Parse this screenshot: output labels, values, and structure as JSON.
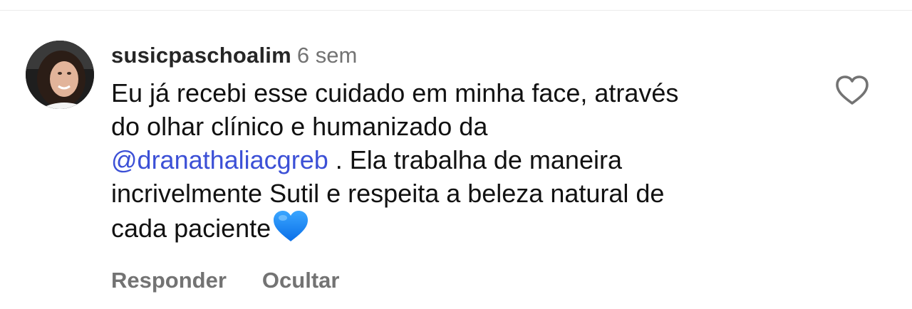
{
  "comment": {
    "username": "susicpaschoalim",
    "time_ago": "6 sem",
    "avatar_icon": "user-avatar-photo",
    "text": {
      "line1": "Eu já recebi  esse cuidado em minha face, através",
      "line2": "do olhar clínico e humanizado da",
      "mention": "@dranathaliacgreb",
      "line3_rest": " . Ela trabalha de maneira",
      "line4": "incrivelmente Sutil e respeita a beleza natural de",
      "line5": "cada paciente",
      "emoji": "blue-heart-emoji"
    },
    "actions": {
      "reply_label": "Responder",
      "hide_label": "Ocultar"
    },
    "like_icon": "heart-outline-icon"
  },
  "colors": {
    "username": "#262626",
    "secondary": "#737373",
    "mention": "#3c50d6",
    "emoji_heart": "#1a8cff"
  }
}
